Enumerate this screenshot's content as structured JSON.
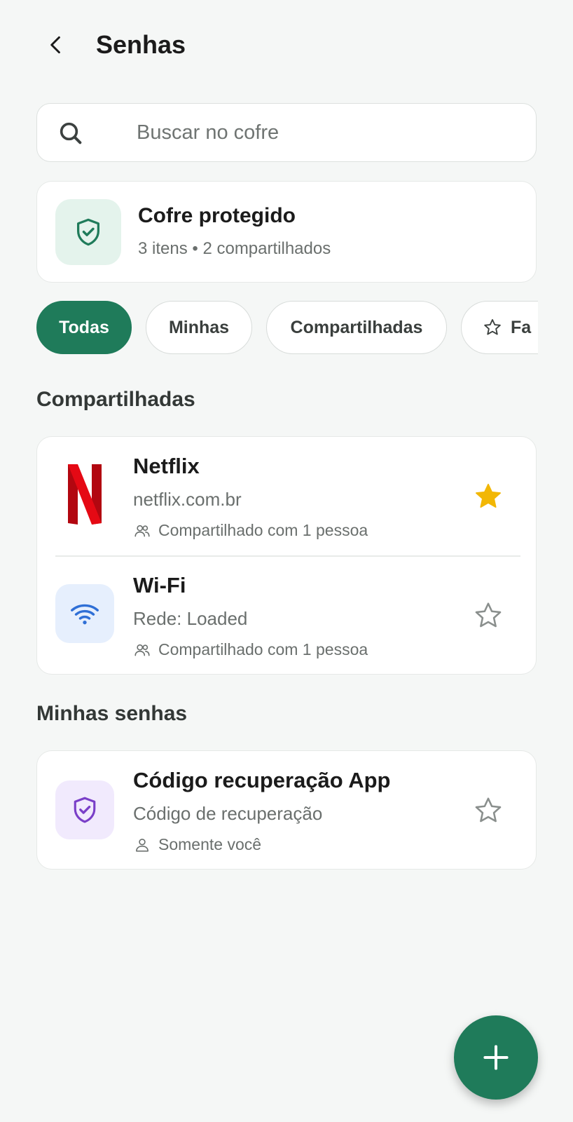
{
  "header": {
    "title": "Senhas"
  },
  "search": {
    "placeholder": "Buscar no cofre"
  },
  "status": {
    "title": "Cofre protegido",
    "subtitle": "3 itens • 2 compartilhados",
    "accent": "#1f7b5a"
  },
  "filters": [
    {
      "label": "Todas",
      "active": true
    },
    {
      "label": "Minhas",
      "active": false
    },
    {
      "label": "Compartilhadas",
      "active": false
    },
    {
      "label": "Fa",
      "active": false,
      "icon": "star-outline-icon"
    }
  ],
  "sections": {
    "shared": {
      "title": "Compartilhadas",
      "items": [
        {
          "name": "Netflix",
          "detail": "netflix.com.br",
          "meta": "Compartilhado com 1 pessoa",
          "favorite": true,
          "icon": "netflix-logo"
        },
        {
          "name": "Wi-Fi",
          "detail": "Rede: Loaded",
          "meta": "Compartilhado com 1 pessoa",
          "favorite": false,
          "icon": "wifi-icon"
        }
      ]
    },
    "mine": {
      "title": "Minhas senhas",
      "items": [
        {
          "name": "Código recuperação App",
          "detail": "Código de recuperação",
          "meta": "Somente você",
          "favorite": false,
          "icon": "shield-check-icon"
        }
      ]
    }
  },
  "colors": {
    "primary": "#1f7b5a",
    "star": "#f2b705",
    "background": "#f5f7f6"
  }
}
